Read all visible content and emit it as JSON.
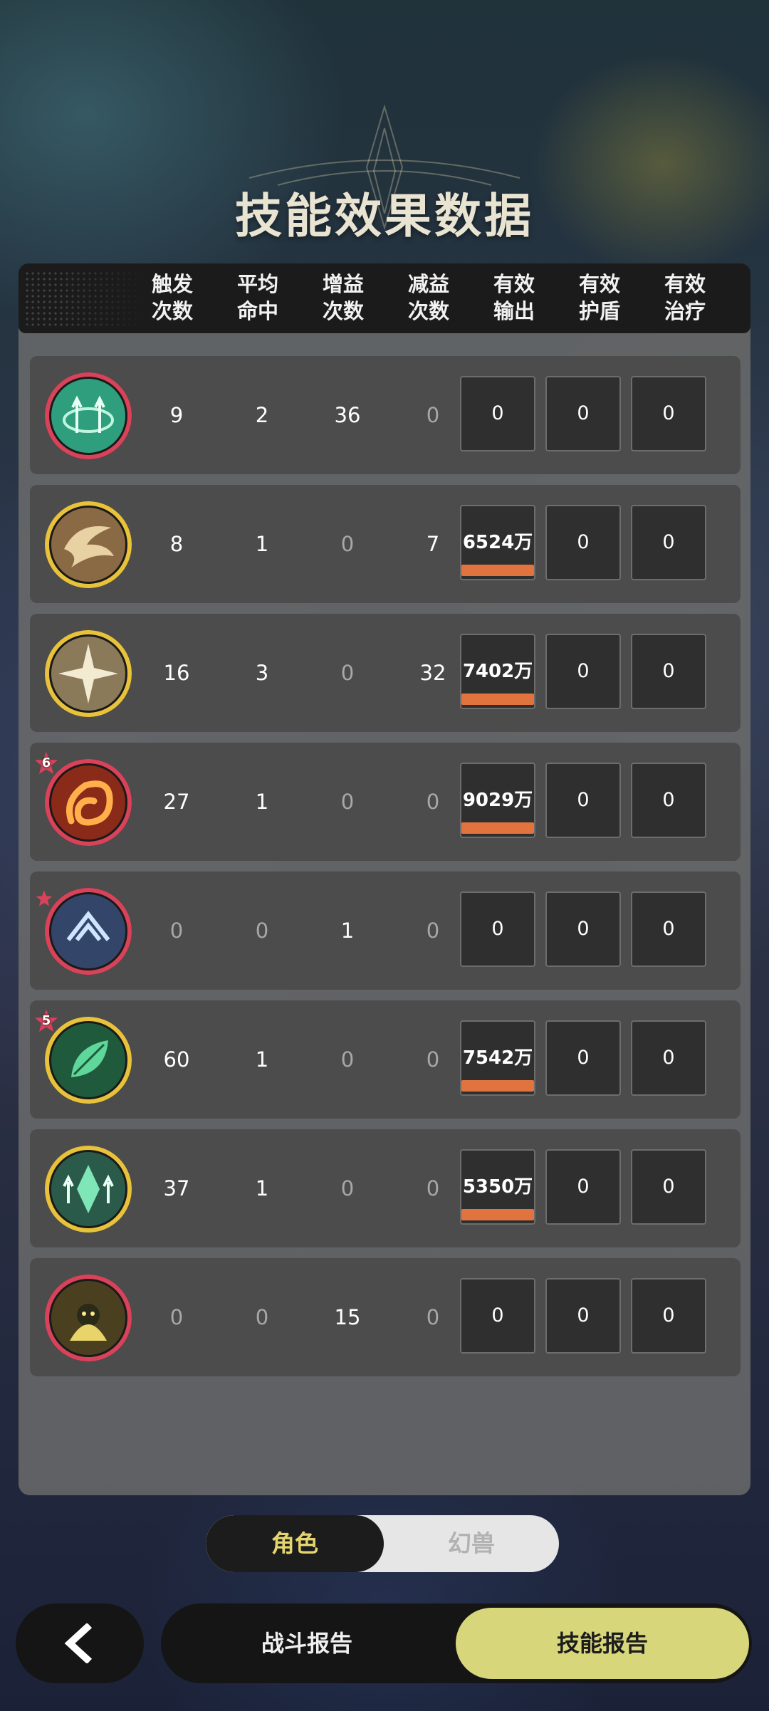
{
  "title": "技能效果数据",
  "columns": [
    {
      "line1": "触发",
      "line2": "次数"
    },
    {
      "line1": "平均",
      "line2": "命中"
    },
    {
      "line1": "增益",
      "line2": "次数"
    },
    {
      "line1": "减益",
      "line2": "次数"
    },
    {
      "line1": "有效",
      "line2": "输出"
    },
    {
      "line1": "有效",
      "line2": "护盾"
    },
    {
      "line1": "有效",
      "line2": "治疗"
    }
  ],
  "rows": [
    {
      "icon": "green-spiral-arrows-skill-icon",
      "frame": "red",
      "star": "",
      "trigger": "9",
      "avg_hit": "2",
      "buff": "36",
      "debuff": "0",
      "output": "0",
      "output_bar": false,
      "shield": "0",
      "heal": "0"
    },
    {
      "icon": "golden-crescent-swirl-skill-icon",
      "frame": "gold",
      "star": "",
      "trigger": "8",
      "avg_hit": "1",
      "buff": "0",
      "debuff": "7",
      "output": "6524万",
      "output_bar": true,
      "shield": "0",
      "heal": "0"
    },
    {
      "icon": "four-point-star-burst-skill-icon",
      "frame": "gold",
      "star": "",
      "trigger": "16",
      "avg_hit": "3",
      "buff": "0",
      "debuff": "32",
      "output": "7402万",
      "output_bar": true,
      "shield": "0",
      "heal": "0"
    },
    {
      "icon": "fire-vortex-skill-icon",
      "frame": "red",
      "star": "6",
      "trigger": "27",
      "avg_hit": "1",
      "buff": "0",
      "debuff": "0",
      "output": "9029万",
      "output_bar": true,
      "shield": "0",
      "heal": "0"
    },
    {
      "icon": "blue-emblem-skill-icon",
      "frame": "red",
      "star": "",
      "trigger": "0",
      "avg_hit": "0",
      "buff": "1",
      "debuff": "0",
      "output": "0",
      "output_bar": false,
      "shield": "0",
      "heal": "0"
    },
    {
      "icon": "green-leaf-orb-skill-icon",
      "frame": "gold",
      "star": "5",
      "trigger": "60",
      "avg_hit": "1",
      "buff": "0",
      "debuff": "0",
      "output": "7542万",
      "output_bar": true,
      "shield": "0",
      "heal": "0"
    },
    {
      "icon": "green-crystal-arrows-skill-icon",
      "frame": "gold",
      "star": "",
      "trigger": "37",
      "avg_hit": "1",
      "buff": "0",
      "debuff": "0",
      "output": "5350万",
      "output_bar": true,
      "shield": "0",
      "heal": "0"
    },
    {
      "icon": "golden-spirit-skill-icon",
      "frame": "red",
      "star": "",
      "trigger": "0",
      "avg_hit": "0",
      "buff": "15",
      "debuff": "0",
      "output": "0",
      "output_bar": false,
      "shield": "0",
      "heal": "0"
    }
  ],
  "toggle": {
    "active": "角色",
    "inactive": "幻兽"
  },
  "bottom_nav": {
    "back_icon": "chevron-left-icon",
    "battle_report": "战斗报告",
    "skill_report": "技能报告"
  },
  "colors": {
    "accent_yellow": "#d7d67a",
    "output_bar": "#e0733e",
    "frame_red": "#d8435a",
    "frame_gold": "#e8c23a"
  }
}
